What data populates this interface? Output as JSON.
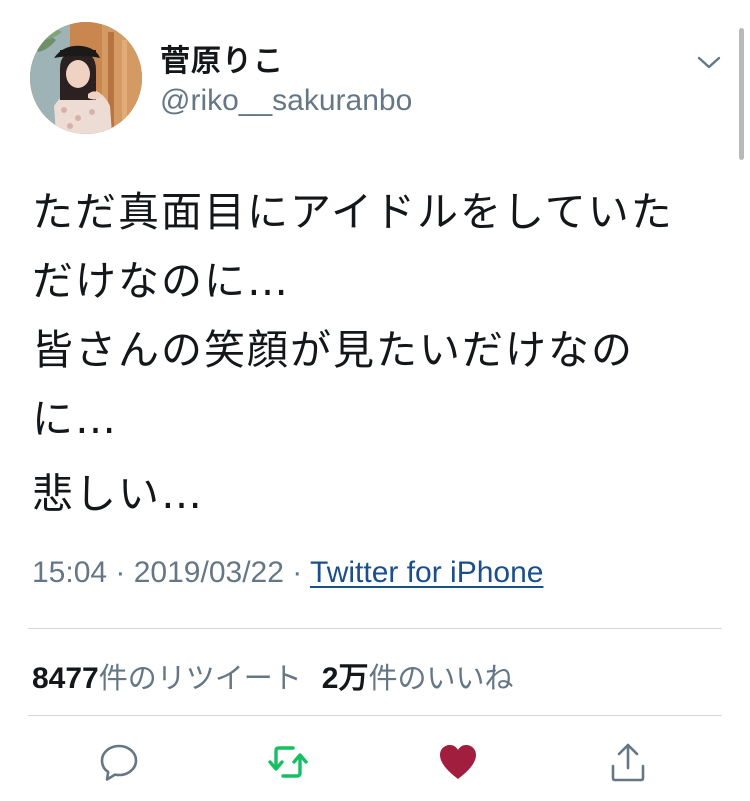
{
  "user": {
    "display_name": "菅原りこ",
    "handle": "@riko__sakuranbo"
  },
  "tweet": {
    "paragraphs": [
      [
        "ただ真面目にアイドルをしていた",
        "だけなのに…",
        "皆さんの笑顔が見たいだけなの",
        "に…"
      ],
      [
        "悲しい…"
      ]
    ]
  },
  "meta": {
    "time": "15:04",
    "separator": " · ",
    "date": "2019/03/22",
    "source": "Twitter for iPhone"
  },
  "stats": {
    "retweets_count": "8477",
    "retweets_label": "件のリツイート",
    "likes_count": "2万",
    "likes_label": "件のいいね"
  },
  "icons": {
    "menu": "chevron-down-icon",
    "reply": "reply-icon",
    "retweet": "retweet-icon",
    "like": "heart-icon",
    "share": "share-icon"
  },
  "colors": {
    "text": "#14171a",
    "secondary": "#657786",
    "retweeted": "#17bf63",
    "liked": "#a11e3f",
    "link": "#1b4f8c"
  }
}
